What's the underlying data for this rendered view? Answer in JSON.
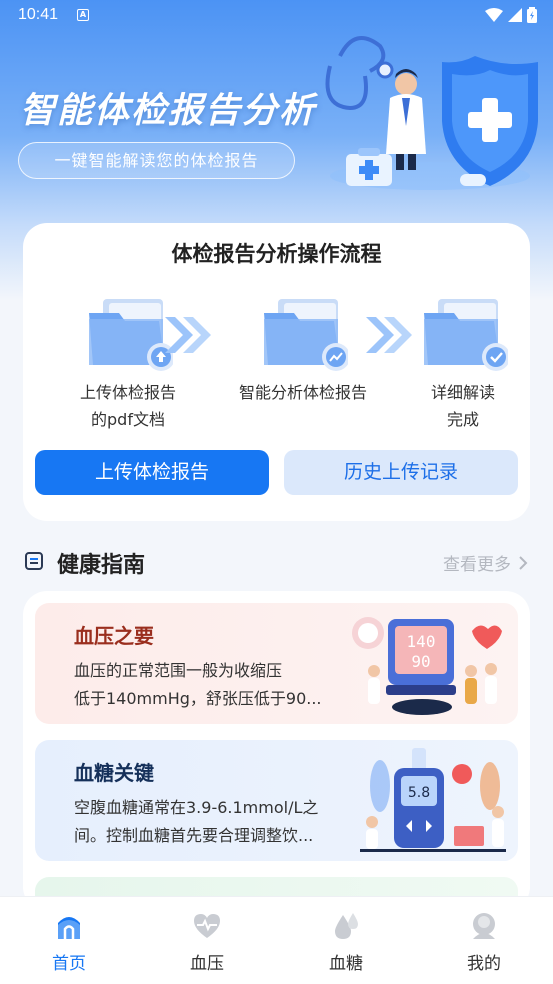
{
  "status_bar": {
    "time": "10:41",
    "indicator": "A"
  },
  "hero": {
    "title": "智能体检报告分析",
    "subtitle": "一键智能解读您的体检报告"
  },
  "flow": {
    "title": "体检报告分析操作流程",
    "steps": [
      {
        "line1": "上传体检报告",
        "line2": "的pdf文档",
        "icon": "upload-icon"
      },
      {
        "line1": "智能分析体检报告",
        "line2": "",
        "icon": "chart-icon"
      },
      {
        "line1": "详细解读",
        "line2": "完成",
        "icon": "check-icon"
      }
    ],
    "upload_button": "上传体检报告",
    "history_button": "历史上传记录"
  },
  "guide_section": {
    "title": "健康指南",
    "more": "查看更多",
    "items": [
      {
        "title": "血压之要",
        "line1": "血压的正常范围一般为收缩压",
        "line2": "低于140mmHg，舒张压低于90...",
        "monitor_top": "140",
        "monitor_bottom": "90"
      },
      {
        "title": "血糖关键",
        "line1": "空腹血糖通常在3.9-6.1mmol/L之",
        "line2": "间。控制血糖首先要合理调整饮...",
        "meter_value": "5.8"
      },
      {
        "title": "",
        "line1": "",
        "line2": ""
      }
    ]
  },
  "tabbar": {
    "tabs": [
      {
        "label": "首页",
        "icon": "home-icon",
        "active": true
      },
      {
        "label": "血压",
        "icon": "heart-icon",
        "active": false
      },
      {
        "label": "血糖",
        "icon": "drop-icon",
        "active": false
      },
      {
        "label": "我的",
        "icon": "profile-icon",
        "active": false
      }
    ]
  },
  "colors": {
    "primary": "#1777f3",
    "hero_top": "#4c93f4",
    "secondary_bg": "#dbe8fb",
    "bp_title": "#9a2e1e",
    "bs_title": "#15305a"
  }
}
